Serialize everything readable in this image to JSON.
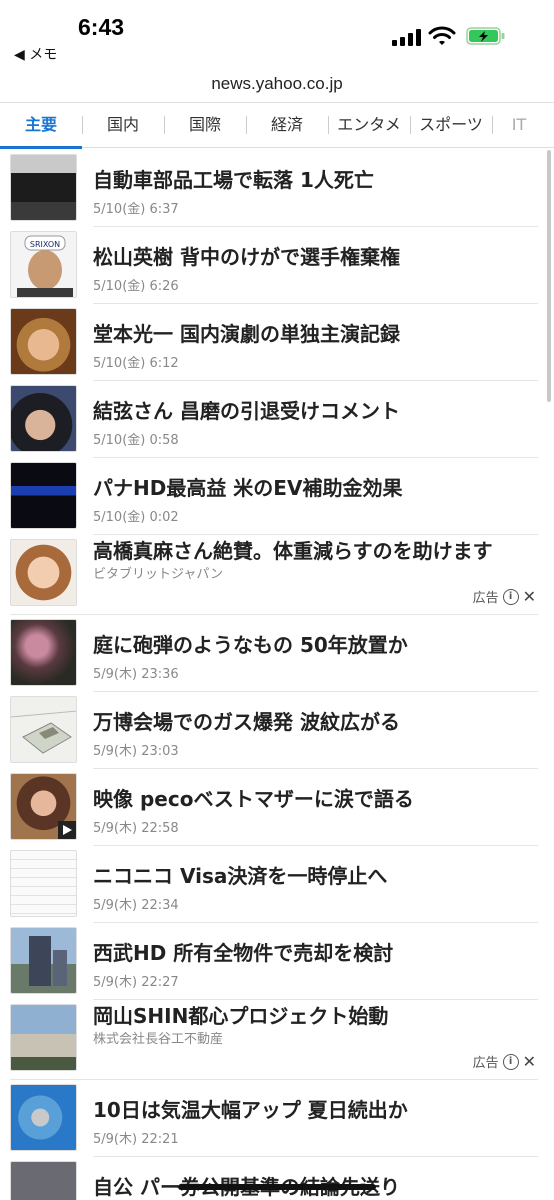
{
  "status": {
    "time": "6:43",
    "back_app": "◀ メモ"
  },
  "url": "news.yahoo.co.jp",
  "tabs": [
    "主要",
    "国内",
    "国際",
    "経済",
    "エンタメ",
    "スポーツ",
    "IT"
  ],
  "news": [
    {
      "title": "自動車部品工場で転落 1人死亡",
      "meta": "5/10(金) 6:37",
      "thumb": "dark-factory"
    },
    {
      "title": "松山英樹 背中のけがで選手権棄権",
      "meta": "5/10(金) 6:26",
      "thumb": "golfer-cap"
    },
    {
      "title": "堂本光一 国内演劇の単独主演記録",
      "meta": "5/10(金) 6:12",
      "thumb": "actor-face"
    },
    {
      "title": "結弦さん 昌磨の引退受けコメント",
      "meta": "5/10(金) 0:58",
      "thumb": "skater-face"
    },
    {
      "title": "パナHD最高益 米のEV補助金効果",
      "meta": "5/10(金) 0:02",
      "thumb": "panasonic-sign"
    },
    {
      "title": "高橋真麻さん絶賛。体重減らすのを助けます",
      "meta": "ビタブリットジャパン",
      "ad": true,
      "ad_label": "広告",
      "thumb": "woman-smile"
    },
    {
      "title": "庭に砲弾のようなもの 50年放置か",
      "meta": "5/9(木) 23:36",
      "thumb": "garden-tree"
    },
    {
      "title": "万博会場でのガス爆発 波紋広がる",
      "meta": "5/9(木) 23:03",
      "thumb": "expo-map"
    },
    {
      "title": "映像 pecoベストマザーに涙で語る",
      "meta": "5/9(木) 22:58",
      "thumb": "peco-video"
    },
    {
      "title": "ニコニコ Visa決済を一時停止へ",
      "meta": "5/9(木) 22:34",
      "thumb": "notice-doc"
    },
    {
      "title": "西武HD 所有全物件で売却を検討",
      "meta": "5/9(木) 22:27",
      "thumb": "building"
    },
    {
      "title": "岡山SHIN都心プロジェクト始動",
      "meta": "株式会社長谷工不動産",
      "ad": true,
      "ad_label": "広告",
      "thumb": "apartment"
    },
    {
      "title": "10日は気温大幅アップ 夏日続出か",
      "meta": "5/9(木) 22:21",
      "thumb": "weather-map"
    },
    {
      "title": "自公 パー券公開基準の結論先送り",
      "meta": "",
      "thumb": "politics"
    }
  ],
  "colors": {
    "accent": "#1a74d2",
    "battery": "#34c759"
  }
}
